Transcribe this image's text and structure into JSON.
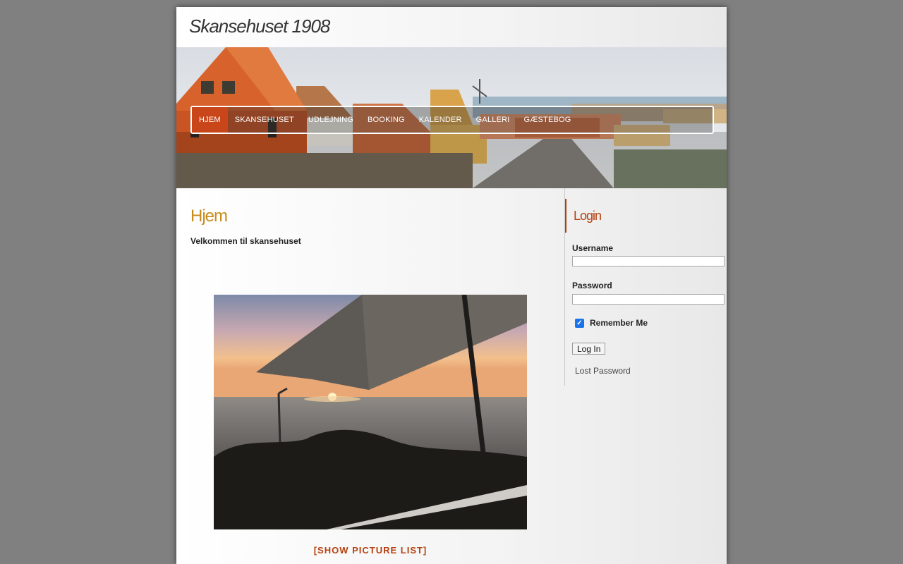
{
  "site": {
    "title": "Skansehuset 1908"
  },
  "nav": {
    "items": [
      {
        "label": "HJEM",
        "active": true
      },
      {
        "label": "SKANSEHUSET",
        "active": false
      },
      {
        "label": "UDLEJNING",
        "active": false
      },
      {
        "label": "BOOKING",
        "active": false
      },
      {
        "label": "KALENDER",
        "active": false
      },
      {
        "label": "GALLERI",
        "active": false
      },
      {
        "label": "GÆSTEBOG",
        "active": false
      }
    ]
  },
  "main": {
    "heading": "Hjem",
    "intro": "Velkommen til skansehuset",
    "show_picture_list": "[SHOW PICTURE LIST]"
  },
  "sidebar": {
    "login": {
      "title": "Login",
      "username_label": "Username",
      "username_value": "",
      "password_label": "Password",
      "password_value": "",
      "remember_label": "Remember Me",
      "remember_checked": true,
      "submit_label": "Log In",
      "lost_password": "Lost Password"
    }
  },
  "colors": {
    "accent": "#b5400f",
    "heading": "#c98b1c",
    "nav_active": "#c8461a",
    "page_background": "#808080"
  }
}
